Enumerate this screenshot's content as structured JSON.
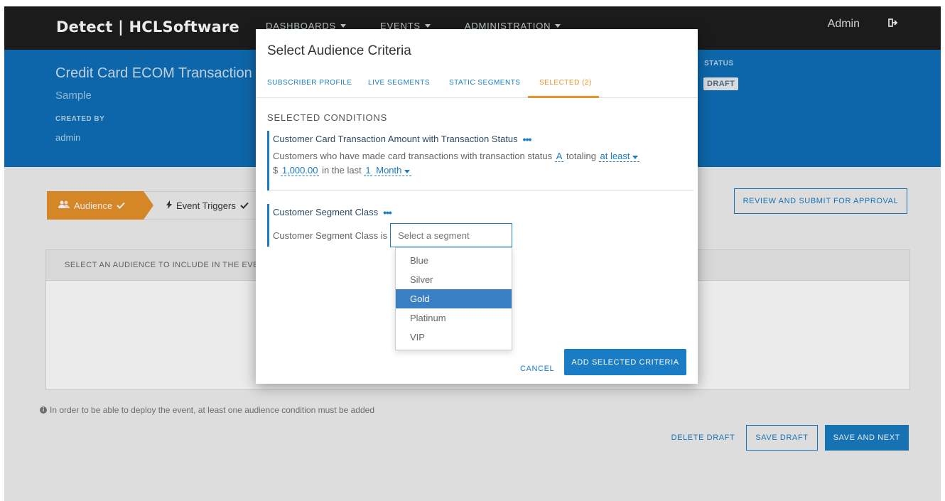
{
  "navbar": {
    "logo": "Detect | HCLSoftware",
    "items": [
      {
        "label": "DASHBOARDS"
      },
      {
        "label": "EVENTS"
      },
      {
        "label": "ADMINISTRATION"
      }
    ],
    "user": "Admin"
  },
  "header": {
    "event_title": "Credit Card ECOM Transaction",
    "event_subtitle": "Sample",
    "created_by_label": "CREATED BY",
    "created_by": "admin",
    "status_label": "STATUS",
    "status": "DRAFT"
  },
  "wizard": {
    "steps": [
      {
        "label": "Audience"
      },
      {
        "label": "Event Triggers"
      }
    ],
    "review_button": "REVIEW AND SUBMIT FOR APPROVAL"
  },
  "panel": {
    "heading": "SELECT AN AUDIENCE TO INCLUDE IN THE EVE"
  },
  "info_note": "In order to be able to deploy the event, at least one audience condition must be added",
  "footer": {
    "delete": "DELETE DRAFT",
    "save": "SAVE DRAFT",
    "save_next": "SAVE AND NEXT"
  },
  "modal": {
    "title": "Select Audience Criteria",
    "tabs": [
      {
        "label": "SUBSCRIBER PROFILE"
      },
      {
        "label": "LIVE SEGMENTS"
      },
      {
        "label": "STATIC SEGMENTS"
      },
      {
        "label": "SELECTED (2)"
      }
    ],
    "section_label": "SELECTED CONDITIONS",
    "condition1": {
      "title": "Customer Card Transaction Amount with Transaction Status",
      "text_a": "Customers who have made card transactions with transaction status",
      "status_value": "A",
      "text_b": "totaling",
      "operator": "at least",
      "currency": "$",
      "amount": "1,000.00",
      "text_c": "in the last",
      "period_value": "1",
      "period_unit": "Month"
    },
    "condition2": {
      "title": "Customer Segment Class",
      "text": "Customer Segment Class is",
      "placeholder": "Select a segment"
    },
    "dropdown_options": [
      {
        "label": "Blue"
      },
      {
        "label": "Silver"
      },
      {
        "label": "Gold"
      },
      {
        "label": "Platinum"
      },
      {
        "label": "VIP"
      }
    ],
    "highlighted_option": "Gold",
    "cancel": "CANCEL",
    "add": "ADD SELECTED CRITERIA"
  },
  "colors": {
    "brand_blue": "#0f6fb8",
    "accent_orange": "#e8922b",
    "primary_button": "#1a7cc4"
  }
}
